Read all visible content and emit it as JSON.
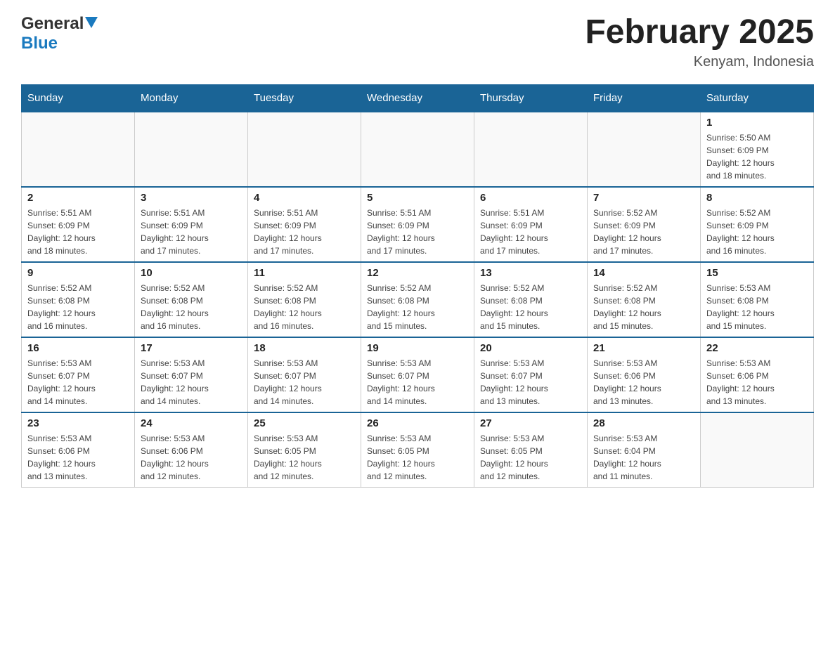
{
  "header": {
    "logo": {
      "general": "General",
      "blue": "Blue"
    },
    "title": "February 2025",
    "subtitle": "Kenyam, Indonesia"
  },
  "calendar": {
    "days_of_week": [
      "Sunday",
      "Monday",
      "Tuesday",
      "Wednesday",
      "Thursday",
      "Friday",
      "Saturday"
    ],
    "weeks": [
      [
        {
          "day": "",
          "info": ""
        },
        {
          "day": "",
          "info": ""
        },
        {
          "day": "",
          "info": ""
        },
        {
          "day": "",
          "info": ""
        },
        {
          "day": "",
          "info": ""
        },
        {
          "day": "",
          "info": ""
        },
        {
          "day": "1",
          "info": "Sunrise: 5:50 AM\nSunset: 6:09 PM\nDaylight: 12 hours\nand 18 minutes."
        }
      ],
      [
        {
          "day": "2",
          "info": "Sunrise: 5:51 AM\nSunset: 6:09 PM\nDaylight: 12 hours\nand 18 minutes."
        },
        {
          "day": "3",
          "info": "Sunrise: 5:51 AM\nSunset: 6:09 PM\nDaylight: 12 hours\nand 17 minutes."
        },
        {
          "day": "4",
          "info": "Sunrise: 5:51 AM\nSunset: 6:09 PM\nDaylight: 12 hours\nand 17 minutes."
        },
        {
          "day": "5",
          "info": "Sunrise: 5:51 AM\nSunset: 6:09 PM\nDaylight: 12 hours\nand 17 minutes."
        },
        {
          "day": "6",
          "info": "Sunrise: 5:51 AM\nSunset: 6:09 PM\nDaylight: 12 hours\nand 17 minutes."
        },
        {
          "day": "7",
          "info": "Sunrise: 5:52 AM\nSunset: 6:09 PM\nDaylight: 12 hours\nand 17 minutes."
        },
        {
          "day": "8",
          "info": "Sunrise: 5:52 AM\nSunset: 6:09 PM\nDaylight: 12 hours\nand 16 minutes."
        }
      ],
      [
        {
          "day": "9",
          "info": "Sunrise: 5:52 AM\nSunset: 6:08 PM\nDaylight: 12 hours\nand 16 minutes."
        },
        {
          "day": "10",
          "info": "Sunrise: 5:52 AM\nSunset: 6:08 PM\nDaylight: 12 hours\nand 16 minutes."
        },
        {
          "day": "11",
          "info": "Sunrise: 5:52 AM\nSunset: 6:08 PM\nDaylight: 12 hours\nand 16 minutes."
        },
        {
          "day": "12",
          "info": "Sunrise: 5:52 AM\nSunset: 6:08 PM\nDaylight: 12 hours\nand 15 minutes."
        },
        {
          "day": "13",
          "info": "Sunrise: 5:52 AM\nSunset: 6:08 PM\nDaylight: 12 hours\nand 15 minutes."
        },
        {
          "day": "14",
          "info": "Sunrise: 5:52 AM\nSunset: 6:08 PM\nDaylight: 12 hours\nand 15 minutes."
        },
        {
          "day": "15",
          "info": "Sunrise: 5:53 AM\nSunset: 6:08 PM\nDaylight: 12 hours\nand 15 minutes."
        }
      ],
      [
        {
          "day": "16",
          "info": "Sunrise: 5:53 AM\nSunset: 6:07 PM\nDaylight: 12 hours\nand 14 minutes."
        },
        {
          "day": "17",
          "info": "Sunrise: 5:53 AM\nSunset: 6:07 PM\nDaylight: 12 hours\nand 14 minutes."
        },
        {
          "day": "18",
          "info": "Sunrise: 5:53 AM\nSunset: 6:07 PM\nDaylight: 12 hours\nand 14 minutes."
        },
        {
          "day": "19",
          "info": "Sunrise: 5:53 AM\nSunset: 6:07 PM\nDaylight: 12 hours\nand 14 minutes."
        },
        {
          "day": "20",
          "info": "Sunrise: 5:53 AM\nSunset: 6:07 PM\nDaylight: 12 hours\nand 13 minutes."
        },
        {
          "day": "21",
          "info": "Sunrise: 5:53 AM\nSunset: 6:06 PM\nDaylight: 12 hours\nand 13 minutes."
        },
        {
          "day": "22",
          "info": "Sunrise: 5:53 AM\nSunset: 6:06 PM\nDaylight: 12 hours\nand 13 minutes."
        }
      ],
      [
        {
          "day": "23",
          "info": "Sunrise: 5:53 AM\nSunset: 6:06 PM\nDaylight: 12 hours\nand 13 minutes."
        },
        {
          "day": "24",
          "info": "Sunrise: 5:53 AM\nSunset: 6:06 PM\nDaylight: 12 hours\nand 12 minutes."
        },
        {
          "day": "25",
          "info": "Sunrise: 5:53 AM\nSunset: 6:05 PM\nDaylight: 12 hours\nand 12 minutes."
        },
        {
          "day": "26",
          "info": "Sunrise: 5:53 AM\nSunset: 6:05 PM\nDaylight: 12 hours\nand 12 minutes."
        },
        {
          "day": "27",
          "info": "Sunrise: 5:53 AM\nSunset: 6:05 PM\nDaylight: 12 hours\nand 12 minutes."
        },
        {
          "day": "28",
          "info": "Sunrise: 5:53 AM\nSunset: 6:04 PM\nDaylight: 12 hours\nand 11 minutes."
        },
        {
          "day": "",
          "info": ""
        }
      ]
    ]
  }
}
